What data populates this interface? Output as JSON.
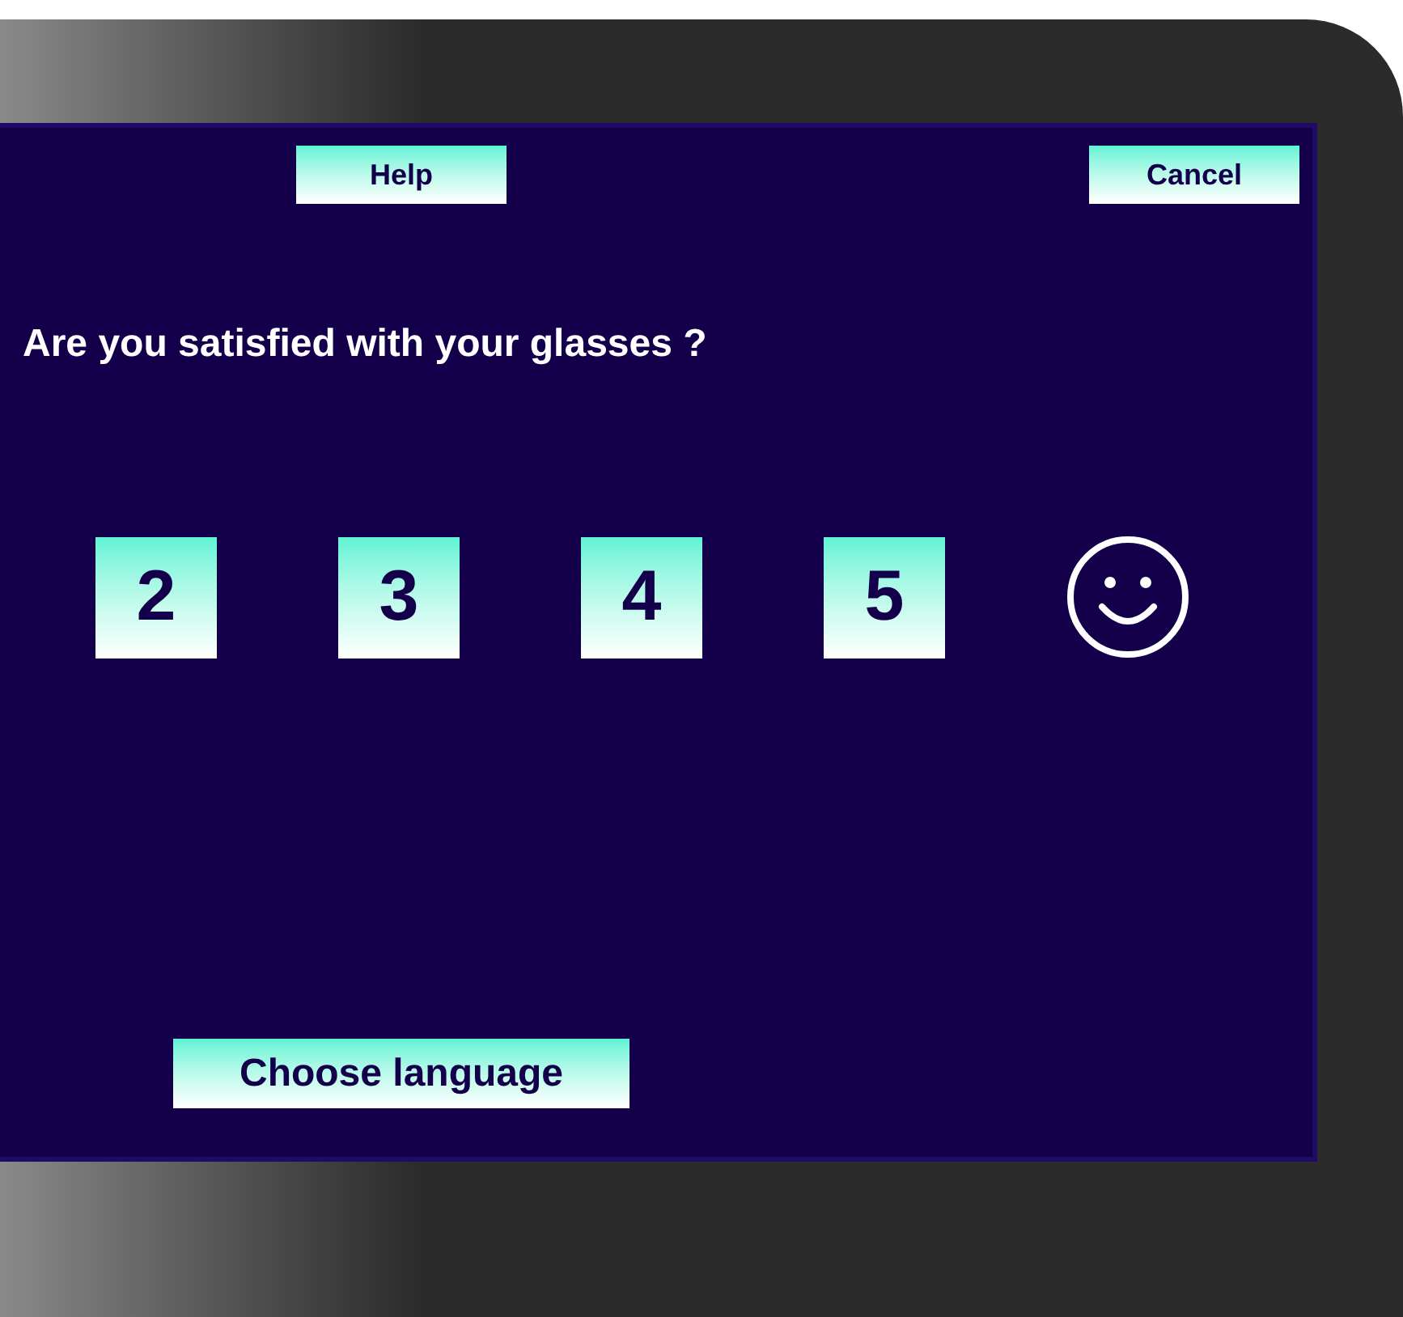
{
  "toolbar": {
    "help": "Help",
    "cancel": "Cancel"
  },
  "question": "Are you satisfied with your glasses ?",
  "options": [
    {
      "kind": "number",
      "label": "2"
    },
    {
      "kind": "number",
      "label": "3"
    },
    {
      "kind": "number",
      "label": "4"
    },
    {
      "kind": "number",
      "label": "5"
    },
    {
      "kind": "smiley"
    }
  ],
  "language_button": "Choose language"
}
